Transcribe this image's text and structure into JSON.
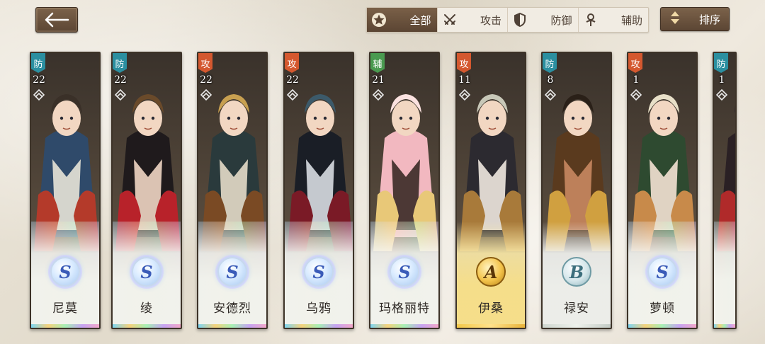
{
  "header": {
    "back_label": "",
    "filters": [
      {
        "label": "全部",
        "icon": "star-icon",
        "active": true
      },
      {
        "label": "攻击",
        "icon": "crossed-swords-icon",
        "active": false
      },
      {
        "label": "防御",
        "icon": "shield-icon",
        "active": false
      },
      {
        "label": "辅助",
        "icon": "support-staff-icon",
        "active": false
      }
    ],
    "sort_label": "排序"
  },
  "heroes": [
    {
      "name": "尼莫",
      "role": "防",
      "level": "22",
      "rank": "S",
      "palette": [
        "#2f4a6a",
        "#b43a2a",
        "#e8e4d8",
        "#3a3028"
      ]
    },
    {
      "name": "绫",
      "role": "防",
      "level": "22",
      "rank": "S",
      "palette": [
        "#1f1a1c",
        "#b8222a",
        "#f0d6c4",
        "#6a4a2a"
      ]
    },
    {
      "name": "安德烈",
      "role": "攻",
      "level": "22",
      "rank": "S",
      "palette": [
        "#2a3a3c",
        "#7a4a24",
        "#e4dcc8",
        "#c8a050"
      ]
    },
    {
      "name": "乌鸦",
      "role": "攻",
      "level": "22",
      "rank": "S",
      "palette": [
        "#1a1e26",
        "#7a1a26",
        "#d8dce2",
        "#3c5a6a"
      ]
    },
    {
      "name": "玛格丽特",
      "role": "辅",
      "level": "21",
      "rank": "S",
      "palette": [
        "#f2b8c0",
        "#e8c878",
        "#3a2a26",
        "#fbe2e0"
      ]
    },
    {
      "name": "伊桑",
      "role": "攻",
      "level": "11",
      "rank": "A",
      "palette": [
        "#2c2a30",
        "#a87a3a",
        "#f0e8e0",
        "#c8c8b8"
      ]
    },
    {
      "name": "禄安",
      "role": "防",
      "level": "8",
      "rank": "B",
      "palette": [
        "#5a3a1e",
        "#d0a040",
        "#c88860",
        "#2a2018"
      ]
    },
    {
      "name": "萝顿",
      "role": "攻",
      "level": "1",
      "rank": "S",
      "palette": [
        "#2e4a30",
        "#c88a4a",
        "#f4e2d4",
        "#e8e0c8"
      ]
    },
    {
      "name": "",
      "role": "防",
      "level": "1",
      "rank": "",
      "palette": [
        "#2a2024",
        "#b02a2a",
        "#f4e0d0",
        "#3a3030"
      ]
    }
  ],
  "colors": {
    "role_def": "#2b8fa0",
    "role_atk": "#d4582f",
    "role_sup": "#4a9a50",
    "button_brown": "#6b533e"
  }
}
